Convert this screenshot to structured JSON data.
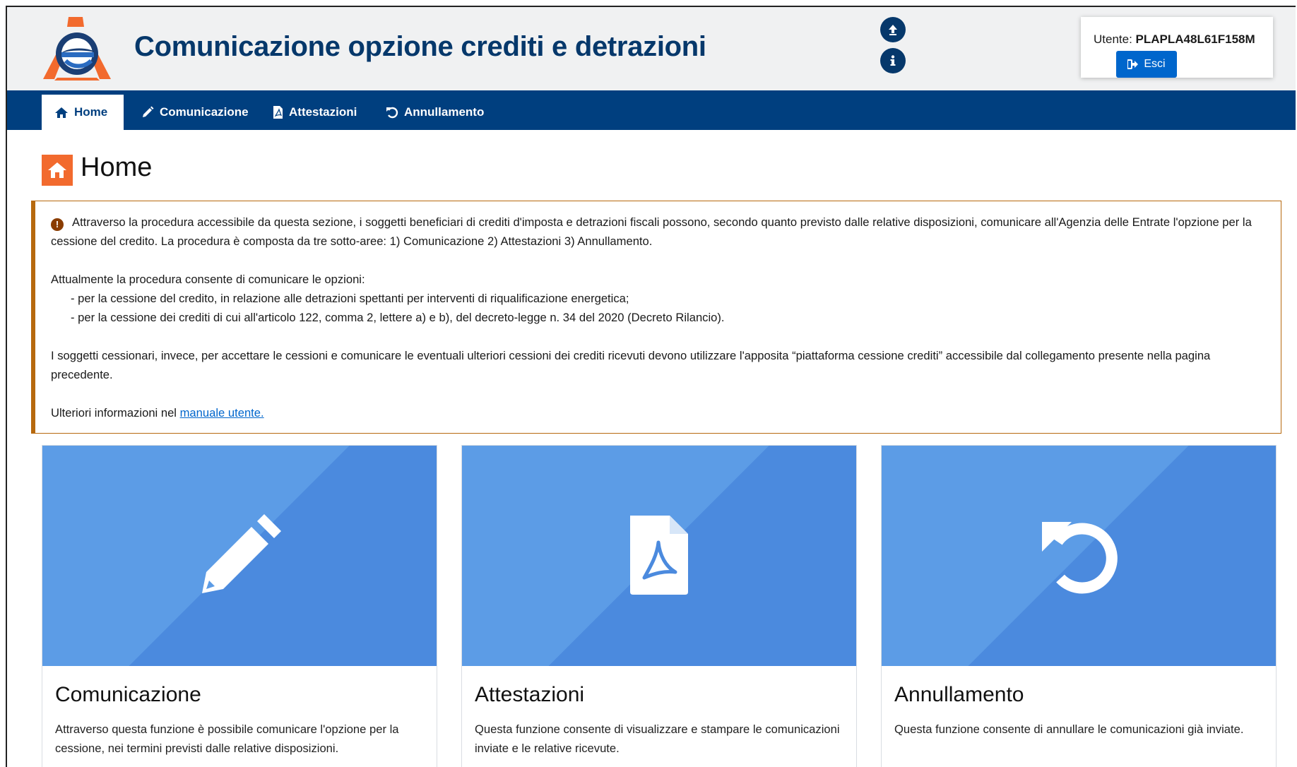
{
  "header": {
    "app_title": "Comunicazione opzione crediti e detrazioni",
    "upload_icon": "upload-circle-icon",
    "info_icon": "info-circle-icon",
    "user_label": "Utente: ",
    "user_code": "PLAPLA48L61F158M",
    "logout_label": "Esci"
  },
  "nav": {
    "items": [
      {
        "label": "Home",
        "icon": "home-icon",
        "active": true
      },
      {
        "label": "Comunicazione",
        "icon": "pencil-icon",
        "active": false
      },
      {
        "label": "Attestazioni",
        "icon": "pdf-file-icon",
        "active": false
      },
      {
        "label": "Annullamento",
        "icon": "undo-icon",
        "active": false
      }
    ]
  },
  "page": {
    "title": "Home"
  },
  "info": {
    "para1": "Attraverso la procedura accessibile da questa sezione, i soggetti beneficiari di crediti d'imposta e detrazioni fiscali possono, secondo quanto previsto dalle relative disposizioni, comunicare all'Agenzia delle Entrate l'opzione per la cessione del credito. La procedura è composta da tre sotto-aree: 1) Comunicazione 2) Attestazioni 3) Annullamento.",
    "para2": "Attualmente la procedura consente di comunicare le opzioni:",
    "bullet1": "- per la cessione del credito, in relazione alle detrazioni spettanti per interventi di riqualificazione energetica;",
    "bullet2": "- per la cessione dei crediti di cui all'articolo 122, comma 2, lettere a) e b), del decreto-legge n. 34 del 2020 (Decreto Rilancio).",
    "para3": "I soggetti cessionari, invece, per accettare le cessioni e comunicare le eventuali ulteriori cessioni dei crediti ricevuti devono utilizzare l'apposita “piattaforma cessione crediti” accessibile dal collegamento presente nella pagina precedente.",
    "para4_prefix": "Ulteriori informazioni nel ",
    "manual_link": "manuale utente."
  },
  "cards": [
    {
      "title": "Comunicazione",
      "description": "Attraverso questa funzione è possibile comunicare l'opzione per la cessione, nei termini previsti dalle relative disposizioni.",
      "icon": "pencil-icon"
    },
    {
      "title": "Attestazioni",
      "description": "Questa funzione consente di visualizzare e stampare le comunicazioni inviate e le relative ricevute.",
      "icon": "pdf-file-icon"
    },
    {
      "title": "Annullamento",
      "description": "Questa funzione consente di annullare le comunicazioni già inviate.",
      "icon": "undo-icon"
    }
  ],
  "colors": {
    "brand_blue": "#003f7f",
    "title_blue": "#06386b",
    "accent_orange": "#f26a2e",
    "card_blue": "#5c9ce6",
    "button_blue": "#0066cc",
    "info_border": "#b7690e"
  }
}
